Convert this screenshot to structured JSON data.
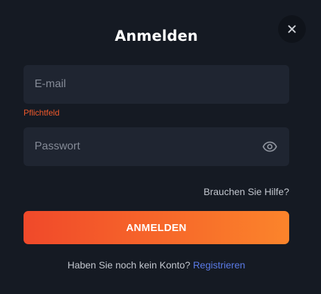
{
  "dialog": {
    "title": "Anmelden",
    "close_icon": "close-icon"
  },
  "form": {
    "email": {
      "placeholder": "E-mail",
      "value": "",
      "error": "Pflichtfeld"
    },
    "password": {
      "placeholder": "Passwort",
      "value": "",
      "toggle_icon": "eye-icon"
    },
    "help_link": "Brauchen Sie Hilfe?",
    "submit_label": "ANMELDEN"
  },
  "footer": {
    "prompt": "Haben Sie noch kein Konto?",
    "register_link": "Registrieren"
  },
  "colors": {
    "background": "#151a23",
    "input_background": "#1f2531",
    "error": "#f0592b",
    "accent_start": "#f0492a",
    "accent_end": "#fb842b",
    "link": "#5b7be8"
  }
}
